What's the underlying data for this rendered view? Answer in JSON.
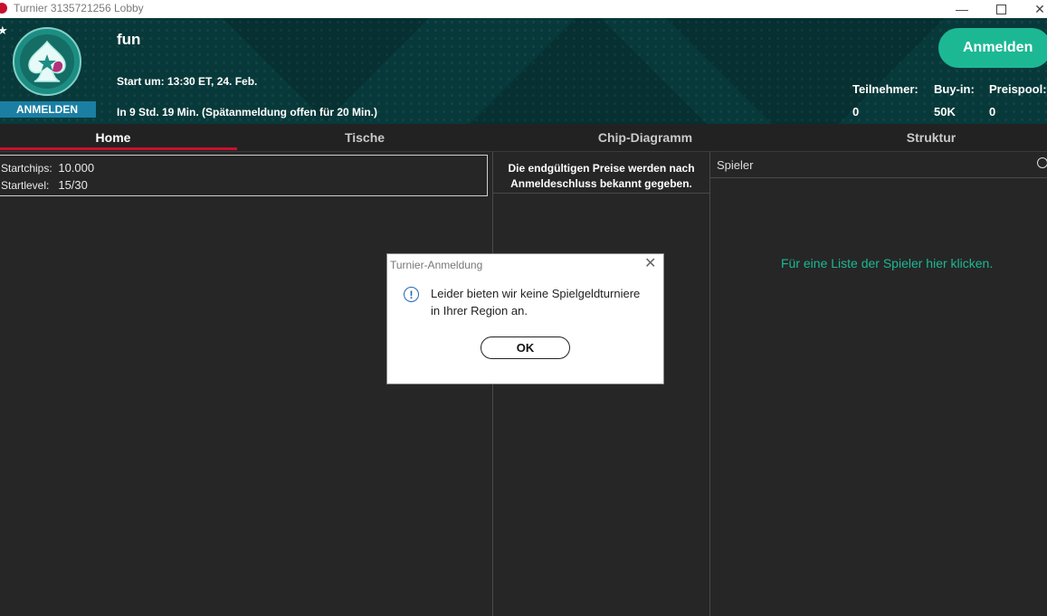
{
  "window": {
    "title": "Turnier 3135721256 Lobby",
    "min_icon": "—",
    "close_icon": "✕"
  },
  "header": {
    "tournament_name": "fun",
    "start_text": "Start um: 13:30 ET, 24. Feb.",
    "late_reg_text": "In 9 Std. 19 Min. (Spätanmeldung offen für 20 Min.)",
    "status_badge": "ANMELDEN",
    "register_label": "Anmelden",
    "stats": [
      {
        "label": "Teilnehmer:",
        "value": "0"
      },
      {
        "label": "Buy-in:",
        "value": "50K"
      },
      {
        "label": "Preispool:",
        "value": "0"
      }
    ]
  },
  "tabs": [
    {
      "label": "Home",
      "active": true
    },
    {
      "label": "Tische",
      "active": false
    },
    {
      "label": "Chip-Diagramm",
      "active": false
    },
    {
      "label": "Struktur",
      "active": false
    }
  ],
  "info": {
    "startchips_label": "Startchips:",
    "startchips_value": "10.000",
    "startlevel_label": "Startlevel:",
    "startlevel_value": "15/30"
  },
  "prizes": {
    "line1": "Die endgültigen Preise werden nach",
    "line2": "Anmeldeschluss bekannt gegeben."
  },
  "players": {
    "title": "Spieler",
    "link_text": "Für eine Liste der Spieler hier klicken."
  },
  "dialog": {
    "title": "Turnier-Anmeldung",
    "line1": "Leider bieten wir keine Spielgeldturniere",
    "line2": "in Ihrer Region an.",
    "ok_label": "OK",
    "close_icon": "✕"
  },
  "colors": {
    "accent": "#1cb894",
    "header_bg": "#08393a",
    "active_tab": "#c8102e",
    "badge": "#1a7fa3",
    "info_icon": "#2167b6"
  }
}
